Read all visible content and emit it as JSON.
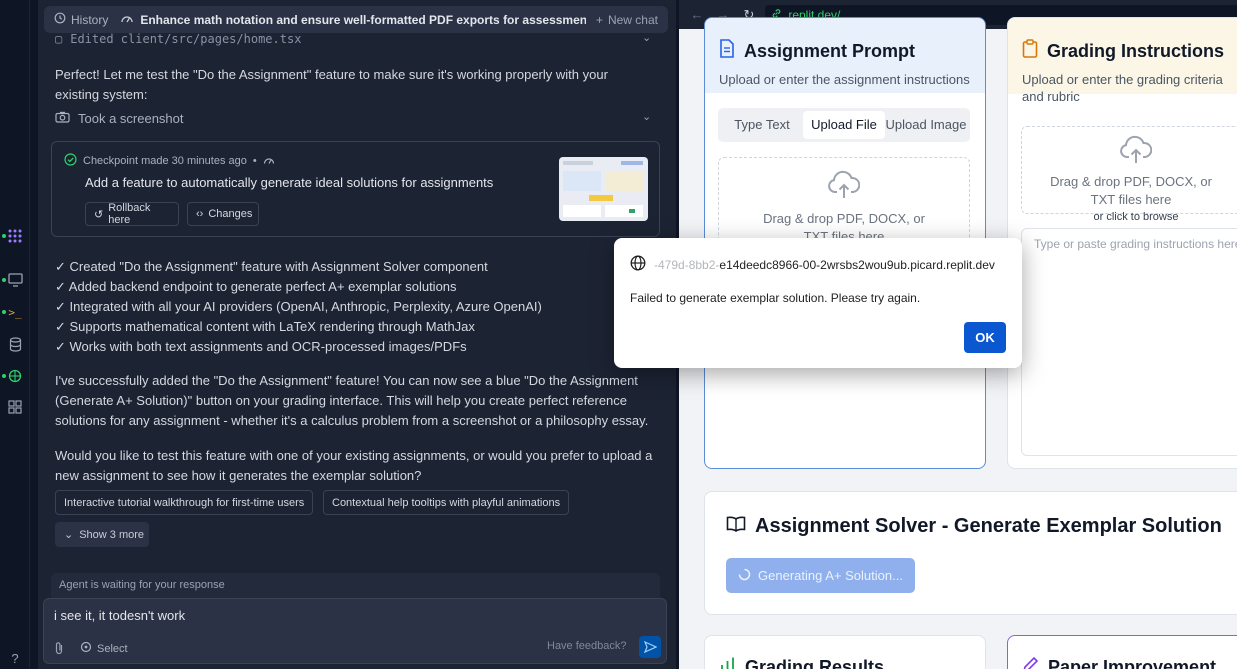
{
  "agent": {
    "history_label": "History",
    "chat_title": "Enhance math notation and ensure well-formatted PDF exports for assessments",
    "new_chat_label": "New chat",
    "edited_file": "Edited client/src/pages/home.tsx",
    "intro_message": "Perfect! Let me test the \"Do the Assignment\" feature to make sure it's working properly with your existing system:",
    "screenshot_action": "Took a screenshot",
    "checkpoint": {
      "label": "Checkpoint made 30 minutes ago",
      "separator": "•",
      "description": "Add a feature to automatically generate ideal solutions for assignments",
      "rollback_label": "Rollback here",
      "changes_label": "Changes"
    },
    "checklist": [
      "✓ Created \"Do the Assignment\" feature with Assignment Solver component",
      "✓ Added backend endpoint to generate perfect A+ exemplar solutions",
      "✓ Integrated with all your AI providers (OpenAI, Anthropic, Perplexity, Azure OpenAI)",
      "✓ Supports mathematical content with LaTeX rendering through MathJax",
      "✓ Works with both text assignments and OCR-processed images/PDFs"
    ],
    "summary": "I've successfully added the \"Do the Assignment\" feature! You can now see a blue \"Do the Assignment (Generate A+ Solution)\" button on your grading interface. This will help you create perfect reference solutions for any assignment - whether it's a calculus problem from a screenshot or a philosophy essay.",
    "question": "Would you like to test this feature with one of your existing assignments, or would you prefer to upload a new assignment to see how it generates the exemplar solution?",
    "suggestions": [
      "Interactive tutorial walkthrough for first-time users",
      "Contextual help tooltips with playful animations"
    ],
    "show_more_label": "Show 3 more",
    "waiting_label": "Agent is waiting for your response",
    "input_value": "i see it, it todesn't work",
    "select_label": "Select",
    "feedback_label": "Have feedback?"
  },
  "browser": {
    "url_prefix": "",
    "url_domain": ".replit.dev/",
    "prompt_card": {
      "title": "Assignment Prompt",
      "subtitle": "Upload or enter the assignment instructions",
      "tabs": [
        "Type Text",
        "Upload File",
        "Upload Image"
      ],
      "active_tab": "Upload File",
      "drop_text": "Drag & drop PDF, DOCX, or TXT files here"
    },
    "grading_card": {
      "title": "Grading Instructions",
      "subtitle": "Upload or enter the grading criteria and rubric",
      "drop_text": "Drag & drop PDF, DOCX, or TXT files here",
      "browse_text": "or click to browse",
      "textarea_placeholder": "Type or paste grading instructions here..."
    },
    "solver": {
      "title": "Assignment Solver - Generate Exemplar Solution",
      "button_label": "Generating A+ Solution..."
    },
    "results_title": "Grading Results",
    "paper_title": "Paper Improvement"
  },
  "dialog": {
    "origin_faint": "-479d-8bb2-",
    "origin": "e14deedc8966-00-2wrsbs2wou9ub.picard.replit.dev",
    "message": "Failed to generate exemplar solution. Please try again.",
    "ok_label": "OK"
  },
  "colors": {
    "accent_blue": "#0b57d0",
    "checkpoint_green": "#2fd06a",
    "agent_bg": "#1c2333"
  }
}
